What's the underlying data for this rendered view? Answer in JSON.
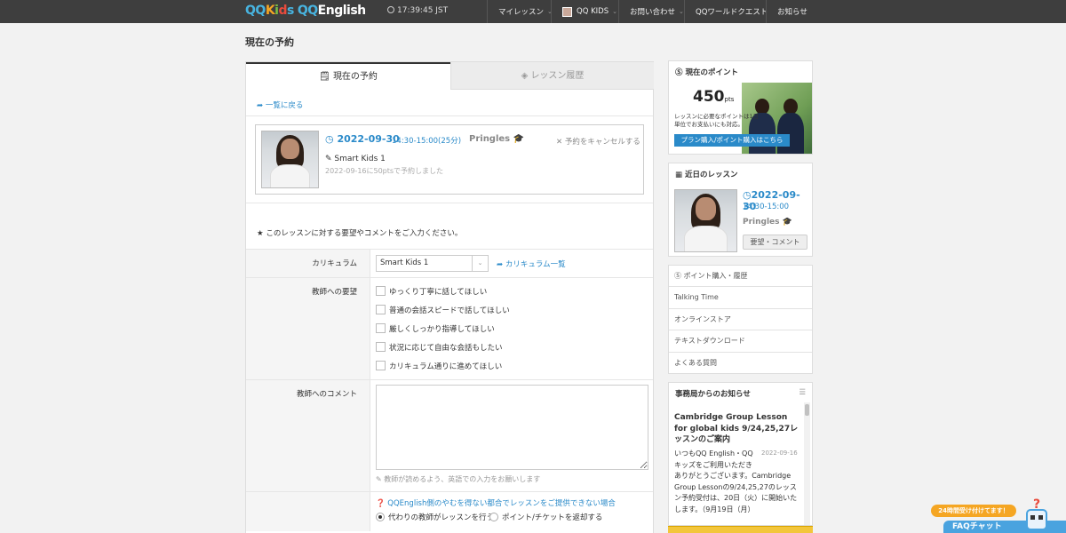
{
  "header": {
    "logo": {
      "qq1": "QQ",
      "k": "K",
      "i": "i",
      "d": "d",
      "s": "s",
      "qq2": "QQ",
      "eng": "English"
    },
    "clock": "17:39:45 JST",
    "nav": [
      {
        "label": "マイレッスン",
        "caret": "⌄"
      },
      {
        "label": "QQ KIDS",
        "caret": "⌄"
      },
      {
        "label": "お問い合わせ",
        "caret": "⌄"
      },
      {
        "label": "QQワールドクエスト"
      },
      {
        "label": "お知らせ"
      }
    ]
  },
  "page_title": "現在の予約",
  "tabs": {
    "current": "現在の予約",
    "history": "レッスン履歴"
  },
  "back_link": "一覧に戻る",
  "lesson": {
    "date": "2022-09-30",
    "time": "14:30-15:00(25分)",
    "teacher": "Pringles",
    "cancel": "予約をキャンセルする",
    "course": "Smart Kids 1",
    "booked": "2022-09-16に50ptsで予約しました"
  },
  "request_note": "このレッスンに対する要望やコメントをご入力ください。",
  "form": {
    "curriculum_label": "カリキュラム",
    "curriculum_value": "Smart Kids 1",
    "curriculum_link": "カリキュラム一覧",
    "requests_label": "教師への要望",
    "requests": [
      "ゆっくり丁寧に話してほしい",
      "普通の会話スピードで話してほしい",
      "厳しくしっかり指導してほしい",
      "状況に応じて自由な会話もしたい",
      "カリキュラム通りに進めてほしい"
    ],
    "comment_label": "教師へのコメント",
    "comment_value": "",
    "comment_hint": "教師が読めるよう、英語での入力をお願いします",
    "alt_help": "QQEnglish側のやむを得ない都合でレッスンをご提供できない場合",
    "alt_option1": "代わりの教師がレッスンを行う",
    "alt_option2": "ポイント/チケットを返却する"
  },
  "sidebar": {
    "points_title": "現在のポイント",
    "points_value": "450",
    "points_unit": "pts",
    "points_note": "レッスンに必要なポイントは1日単位でお支払いにも対応。",
    "points_button": "プラン購入/ポイント購入はこちら",
    "upcoming_title": "近日のレッスン",
    "upcoming_date": "2022-09-30",
    "upcoming_time": "14:30-15:00",
    "upcoming_teacher": "Pringles",
    "upcoming_button": "要望・コメント",
    "links": [
      "ポイント購入・履歴",
      "Talking Time",
      "オンラインストア",
      "テキストダウンロード",
      "よくある質問"
    ],
    "news_title": "事務局からのお知らせ",
    "news_item_title": "Cambridge Group Lesson for global kids 9/24,25,27レッスンのご案内",
    "news_item_date": "2022-09-16",
    "news_item_body": "いつもQQ English・QQキッズをご利用いただき",
    "news_item_body2": "ありがとうございます。Cambridge Group Lessonの9/24,25,27のレッスン予約受付は、20日（火）に開始いたします。（9月19日（月）"
  },
  "faq": {
    "badge": "24時間受け付けてます！",
    "chat": "FAQチャット"
  }
}
